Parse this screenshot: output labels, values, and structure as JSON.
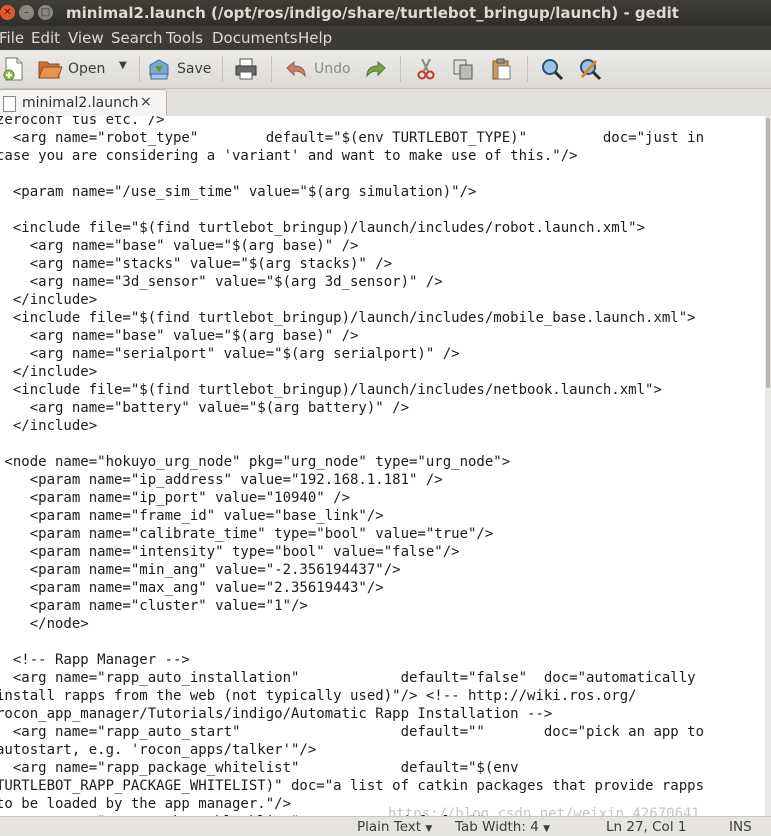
{
  "window": {
    "title": "minimal2.launch (/opt/ros/indigo/share/turtlebot_bringup/launch) - gedit",
    "buttons": {
      "close": "✕",
      "minimize": "–",
      "maximize": "□"
    }
  },
  "menu": [
    "File",
    "Edit",
    "View",
    "Search",
    "Tools",
    "Documents",
    "Help"
  ],
  "toolbar": {
    "open_label": "Open",
    "save_label": "Save",
    "undo_label": "Undo"
  },
  "tab": {
    "label": "minimal2.launch",
    "close": "×"
  },
  "editor": {
    "lines": [
      "zeroconf tus etc. />",
      "  <arg name=\"robot_type\"        default=\"$(env TURTLEBOT_TYPE)\"         doc=\"just in",
      "case you are considering a 'variant' and want to make use of this.\"/>",
      "",
      "  <param name=\"/use_sim_time\" value=\"$(arg simulation)\"/>",
      "",
      "  <include file=\"$(find turtlebot_bringup)/launch/includes/robot.launch.xml\">",
      "    <arg name=\"base\" value=\"$(arg base)\" />",
      "    <arg name=\"stacks\" value=\"$(arg stacks)\" />",
      "    <arg name=\"3d_sensor\" value=\"$(arg 3d_sensor)\" />",
      "  </include>",
      "  <include file=\"$(find turtlebot_bringup)/launch/includes/mobile_base.launch.xml\">",
      "    <arg name=\"base\" value=\"$(arg base)\" />",
      "    <arg name=\"serialport\" value=\"$(arg serialport)\" />",
      "  </include>",
      "  <include file=\"$(find turtlebot_bringup)/launch/includes/netbook.launch.xml\">",
      "    <arg name=\"battery\" value=\"$(arg battery)\" />",
      "  </include>",
      "",
      " <node name=\"hokuyo_urg_node\" pkg=\"urg_node\" type=\"urg_node\">",
      "    <param name=\"ip_address\" value=\"192.168.1.181\" />",
      "    <param name=\"ip_port\" value=\"10940\" />",
      "    <param name=\"frame_id\" value=\"base_link\"/>",
      "    <param name=\"calibrate_time\" type=\"bool\" value=\"true\"/>",
      "    <param name=\"intensity\" type=\"bool\" value=\"false\"/>",
      "    <param name=\"min_ang\" value=\"-2.356194437\"/>",
      "    <param name=\"max_ang\" value=\"2.35619443\"/>",
      "    <param name=\"cluster\" value=\"1\"/>",
      "    </node>",
      "",
      "  <!-- Rapp Manager -->",
      "  <arg name=\"rapp_auto_installation\"            default=\"false\"  doc=\"automatically",
      "install rapps from the web (not typically used)\"/> <!-- http://wiki.ros.org/",
      "rocon_app_manager/Tutorials/indigo/Automatic Rapp Installation -->",
      "  <arg name=\"rapp_auto_start\"                   default=\"\"       doc=\"pick an app to",
      "autostart, e.g. 'rocon_apps/talker'\"/>",
      "  <arg name=\"rapp_package_whitelist\"            default=\"$(env",
      "TURTLEBOT_RAPP_PACKAGE_WHITELIST)\" doc=\"a list of catkin packages that provide rapps",
      "to be loaded by the app manager.\"/>",
      "  <arg name=\"rapp_package_blacklist\"            default=\"\""
    ]
  },
  "statusbar": {
    "language": "Plain Text",
    "tab_width": "Tab Width: 4",
    "position": "Ln 27, Col 1",
    "mode": "INS"
  },
  "watermark": "https://blog.csdn.net/weixin_42670641"
}
